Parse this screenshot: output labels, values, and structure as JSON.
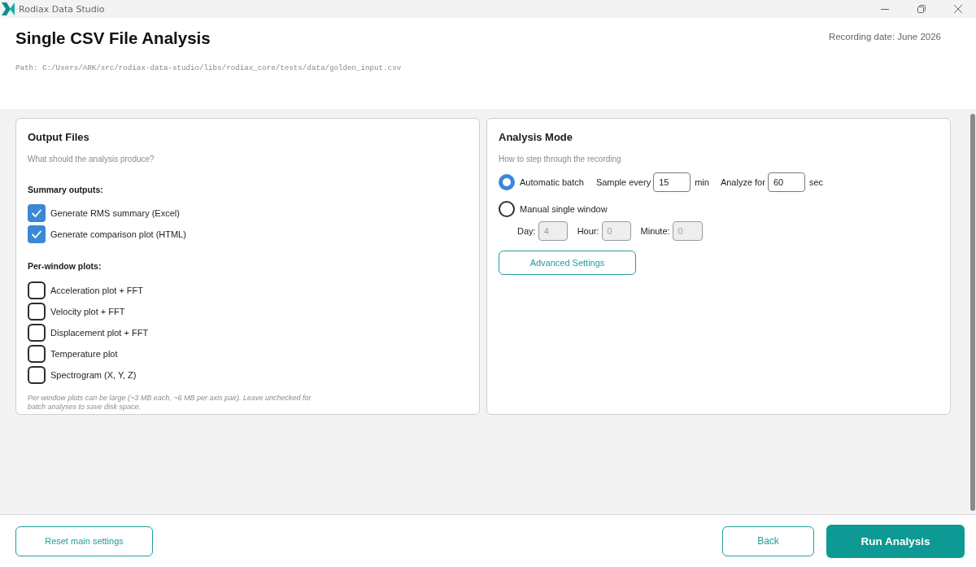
{
  "window": {
    "title": "Rodiax Data Studio"
  },
  "header": {
    "title": "Single CSV File Analysis",
    "path": "Path: C:/Users/ARK/src/rodiax-data-studio/libs/rodiax_core/tests/data/golden_input.csv",
    "recording_date": "Recording date: June 2026"
  },
  "output_files": {
    "title": "Output Files",
    "subtitle": "What should the analysis produce?",
    "groups": [
      {
        "heading": "Summary outputs:",
        "items": [
          {
            "label": "Generate RMS summary (Excel)",
            "checked": true
          },
          {
            "label": "Generate comparison plot (HTML)",
            "checked": true
          }
        ]
      },
      {
        "heading": "Per-window plots:",
        "items": [
          {
            "label": "Acceleration plot + FFT",
            "checked": false
          },
          {
            "label": "Velocity plot + FFT",
            "checked": false
          },
          {
            "label": "Displacement plot + FFT",
            "checked": false
          },
          {
            "label": "Temperature plot",
            "checked": false
          },
          {
            "label": "Spectrogram (X, Y, Z)",
            "checked": false
          }
        ]
      }
    ],
    "note": "Per-window plots can be large (~3 MB each, ~6 MB per axis pair). Leave unchecked for batch analyses to save disk space."
  },
  "analysis_mode": {
    "title": "Analysis Mode",
    "subtitle": "How to step through the recording",
    "modes": [
      {
        "label": "Automatic batch",
        "selected": true,
        "inline_fields": [
          {
            "label": "Sample every",
            "value": "15",
            "unit": "min",
            "disabled": false
          },
          {
            "label": "Analyze for",
            "value": "60",
            "unit": "sec",
            "disabled": false
          }
        ]
      },
      {
        "label": "Manual single window",
        "selected": false,
        "sub_fields": [
          {
            "label": "Day:",
            "value": "4",
            "disabled": true
          },
          {
            "label": "Hour:",
            "value": "0",
            "disabled": true
          },
          {
            "label": "Minute:",
            "value": "0",
            "disabled": true
          }
        ]
      }
    ],
    "advanced_button": "Advanced Settings"
  },
  "footer": {
    "reset_button": "Reset main settings",
    "back_button": "Back",
    "run_button": "Run Analysis"
  }
}
